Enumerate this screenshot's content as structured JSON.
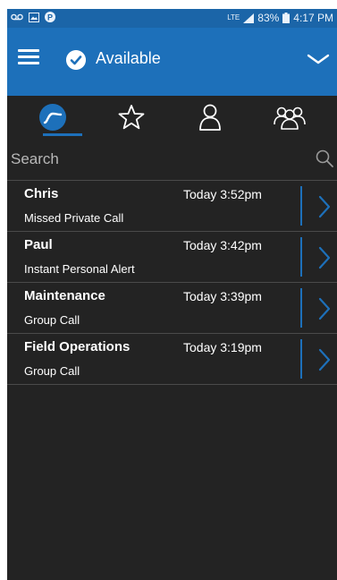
{
  "status_bar": {
    "battery": "83%",
    "time": "4:17 PM",
    "network": "LTE",
    "left_icons": [
      "voicemail-icon",
      "image-icon",
      "p-icon"
    ]
  },
  "app_bar": {
    "presence_label": "Available",
    "menu_icon": "hamburger-icon",
    "presence_icon": "check-circle-icon",
    "expand_icon": "chevron-down-icon"
  },
  "tabs": [
    {
      "name": "recents",
      "icon": "recents-icon",
      "selected": true
    },
    {
      "name": "favorites",
      "icon": "star-icon",
      "selected": false
    },
    {
      "name": "contacts",
      "icon": "person-icon",
      "selected": false
    },
    {
      "name": "groups",
      "icon": "group-icon",
      "selected": false
    }
  ],
  "search": {
    "placeholder": "Search",
    "value": ""
  },
  "history": [
    {
      "name": "Chris",
      "time": "Today 3:52pm",
      "detail": "Missed Private Call"
    },
    {
      "name": "Paul",
      "time": "Today 3:42pm",
      "detail": "Instant Personal Alert"
    },
    {
      "name": "Maintenance",
      "time": "Today 3:39pm",
      "detail": "Group Call"
    },
    {
      "name": "Field Operations",
      "time": "Today 3:19pm",
      "detail": "Group Call"
    }
  ],
  "colors": {
    "accent": "#1d70ba",
    "status_bar": "#1b65a8",
    "background": "#232323",
    "divider": "#4a4a4a"
  }
}
